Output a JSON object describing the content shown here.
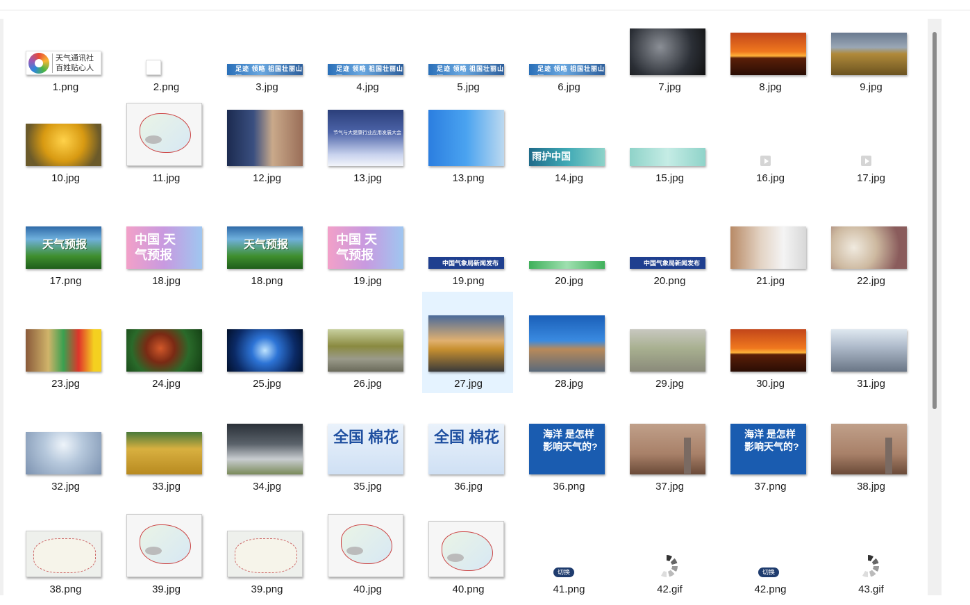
{
  "window": {
    "title": ""
  },
  "files": [
    [
      {
        "name": "1.png",
        "icon": "weather-agency-logo",
        "logo_text": [
          "天气通讯社",
          "百姓贴心人"
        ]
      },
      {
        "name": "2.png",
        "icon": "blank-image"
      },
      {
        "name": "3.jpg",
        "icon": "banner-image",
        "banner_text": "足迹 领略 祖国壮丽山河"
      },
      {
        "name": "4.jpg",
        "icon": "banner-image",
        "banner_text": "足迹 领略 祖国壮丽山河"
      },
      {
        "name": "5.jpg",
        "icon": "banner-image",
        "banner_text": "足迹 领略 祖国壮丽山河"
      },
      {
        "name": "6.jpg",
        "icon": "banner-image",
        "banner_text": "足迹 领略 祖国壮丽山河"
      },
      {
        "name": "7.jpg",
        "icon": "satellite-photo"
      },
      {
        "name": "8.jpg",
        "icon": "sunset-photo"
      },
      {
        "name": "9.jpg",
        "icon": "wetland-photo"
      }
    ],
    [
      {
        "name": "10.jpg",
        "icon": "ginkgo-photo"
      },
      {
        "name": "11.jpg",
        "icon": "weather-map"
      },
      {
        "name": "12.jpg",
        "icon": "presenter-photo"
      },
      {
        "name": "13.jpg",
        "icon": "conference-photo",
        "caption": "节气与大健康行业应用发展大会"
      },
      {
        "name": "13.png",
        "icon": "presenter-photo"
      },
      {
        "name": "14.jpg",
        "icon": "banner-image",
        "banner_text": "雨护中国"
      },
      {
        "name": "15.jpg",
        "icon": "banner-image"
      },
      {
        "name": "16.jpg",
        "icon": "video-icon"
      },
      {
        "name": "17.jpg",
        "icon": "video-icon"
      }
    ],
    [
      {
        "name": "17.png",
        "icon": "forecast-card",
        "caption": "天气预报"
      },
      {
        "name": "18.jpg",
        "icon": "forecast-card",
        "caption": "中国 天气预报"
      },
      {
        "name": "18.png",
        "icon": "forecast-card",
        "caption": "天气预报"
      },
      {
        "name": "19.jpg",
        "icon": "forecast-card",
        "caption": "中国 天气预报"
      },
      {
        "name": "19.png",
        "icon": "press-banner",
        "caption": "中国气象局新闻发布会"
      },
      {
        "name": "20.jpg",
        "icon": "banner-image"
      },
      {
        "name": "20.png",
        "icon": "press-banner",
        "caption": "中国气象局新闻发布会"
      },
      {
        "name": "21.jpg",
        "icon": "hand-photo"
      },
      {
        "name": "22.jpg",
        "icon": "garlic-photo"
      }
    ],
    [
      {
        "name": "23.jpg",
        "icon": "street-photo"
      },
      {
        "name": "24.jpg",
        "icon": "fruit-photo"
      },
      {
        "name": "25.jpg",
        "icon": "frost-photo"
      },
      {
        "name": "26.jpg",
        "icon": "path-photo"
      },
      {
        "name": "27.jpg",
        "icon": "temple-photo",
        "selected": true
      },
      {
        "name": "28.jpg",
        "icon": "castle-photo"
      },
      {
        "name": "29.jpg",
        "icon": "walk-photo"
      },
      {
        "name": "30.jpg",
        "icon": "sunset-photo"
      },
      {
        "name": "31.jpg",
        "icon": "umbrella-photo"
      }
    ],
    [
      {
        "name": "32.jpg",
        "icon": "halo-photo"
      },
      {
        "name": "33.jpg",
        "icon": "wheat-photo"
      },
      {
        "name": "34.jpg",
        "icon": "storm-photo"
      },
      {
        "name": "35.jpg",
        "icon": "cotton-card",
        "caption": "全国 棉花"
      },
      {
        "name": "36.jpg",
        "icon": "cotton-card",
        "caption": "全国 棉花"
      },
      {
        "name": "36.png",
        "icon": "ocean-card",
        "caption": "海洋 是怎样影响天气的?"
      },
      {
        "name": "37.jpg",
        "icon": "haze-photo"
      },
      {
        "name": "37.png",
        "icon": "ocean-card",
        "caption": "海洋 是怎样影响天气的?"
      },
      {
        "name": "38.jpg",
        "icon": "haze-photo"
      }
    ],
    [
      {
        "name": "38.png",
        "icon": "china-map"
      },
      {
        "name": "39.jpg",
        "icon": "weather-map"
      },
      {
        "name": "39.png",
        "icon": "china-map"
      },
      {
        "name": "40.jpg",
        "icon": "weather-map"
      },
      {
        "name": "40.png",
        "icon": "china-map"
      },
      {
        "name": "41.png",
        "icon": "switch-button",
        "caption": "切换"
      },
      {
        "name": "42.gif",
        "icon": "loading-spinner"
      },
      {
        "name": "42.png",
        "icon": "switch-button",
        "caption": "切换"
      },
      {
        "name": "43.gif",
        "icon": "loading-spinner"
      }
    ]
  ]
}
